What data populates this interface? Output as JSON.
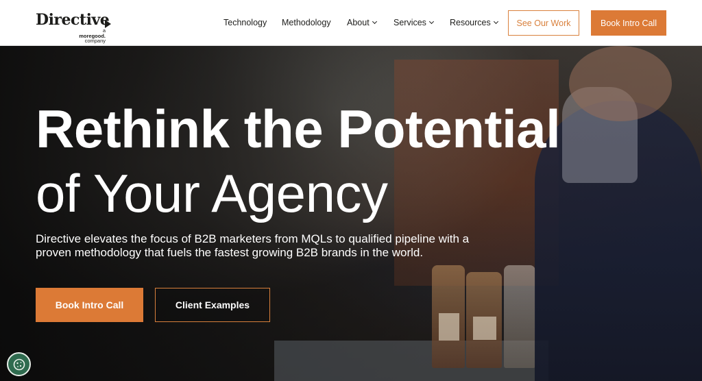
{
  "brand": {
    "name": "Directive",
    "sub_prefix": "a",
    "sub_brand": "moregood.",
    "sub_suffix": "company"
  },
  "nav": {
    "items": [
      {
        "label": "Technology"
      },
      {
        "label": "Methodology"
      },
      {
        "label": "About"
      },
      {
        "label": "Services"
      },
      {
        "label": "Resources"
      }
    ],
    "see_work_label": "See Our Work",
    "book_call_label": "Book Intro Call"
  },
  "hero": {
    "title_line1": "Rethink the Potential",
    "title_line2": "of Your Agency",
    "description": "Directive elevates the focus of B2B marketers from MQLs to qualified pipeline with a proven methodology that fuels the fastest growing B2B brands in the world.",
    "primary_cta": "Book Intro Call",
    "secondary_cta": "Client Examples"
  },
  "colors": {
    "accent": "#dc7a36",
    "text_dark": "#1d1d1b",
    "cookie_bg": "#2f6b4f"
  },
  "icons": {
    "cookie": "cookie-icon",
    "chevron": "chevron-down-icon"
  }
}
